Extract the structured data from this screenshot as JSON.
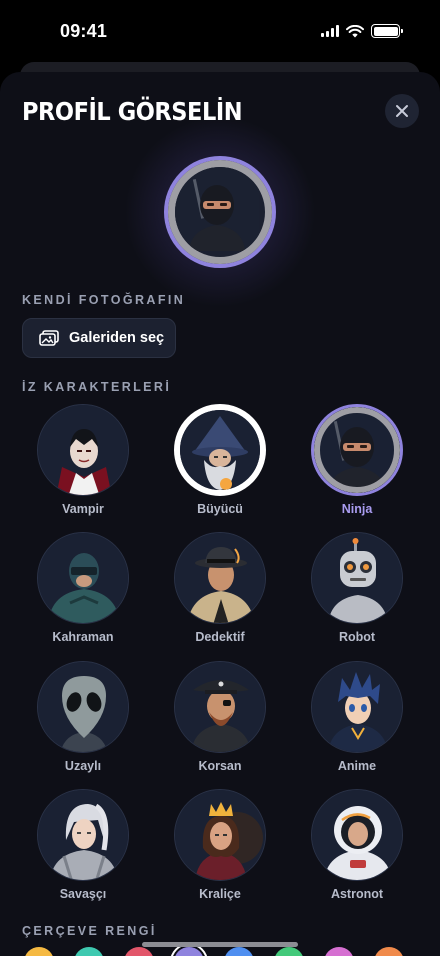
{
  "status": {
    "time": "09:41"
  },
  "sheet": {
    "title": "PROFİL GÖRSELİN",
    "own_photo_label": "KENDİ FOTOĞRAFIN",
    "gallery_button": "Galeriden seç",
    "characters_label": "İZ KARAKTERLERİ",
    "frame_color_label": "ÇERÇEVE RENGİ"
  },
  "characters": [
    {
      "name": "Vampir",
      "icon": "vampire-avatar",
      "state": "normal"
    },
    {
      "name": "Büyücü",
      "icon": "wizard-avatar",
      "state": "selected-white"
    },
    {
      "name": "Ninja",
      "icon": "ninja-avatar",
      "state": "selected"
    },
    {
      "name": "Kahraman",
      "icon": "hero-avatar",
      "state": "normal"
    },
    {
      "name": "Dedektif",
      "icon": "detective-avatar",
      "state": "normal"
    },
    {
      "name": "Robot",
      "icon": "robot-avatar",
      "state": "normal"
    },
    {
      "name": "Uzaylı",
      "icon": "alien-avatar",
      "state": "normal"
    },
    {
      "name": "Korsan",
      "icon": "pirate-avatar",
      "state": "normal"
    },
    {
      "name": "Anime",
      "icon": "anime-avatar",
      "state": "normal"
    },
    {
      "name": "Savaşçı",
      "icon": "warrior-avatar",
      "state": "normal"
    },
    {
      "name": "Kraliçe",
      "icon": "queen-avatar",
      "state": "normal"
    },
    {
      "name": "Astronot",
      "icon": "astronaut-avatar",
      "state": "normal"
    }
  ],
  "frame_colors": [
    "#f5b942",
    "#3ec9b0",
    "#e2566a",
    "#8f83de",
    "#4f8ff0",
    "#43c97a",
    "#d56fd1",
    "#f08a4b"
  ],
  "colors": {
    "accent": "#8f83de",
    "sheet_bg": "#0e0f17"
  }
}
